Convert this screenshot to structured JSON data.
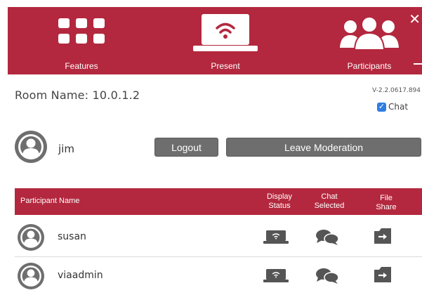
{
  "nav": {
    "features_label": "Features",
    "present_label": "Present",
    "participants_label": "Participants",
    "close_label": "✕"
  },
  "room": {
    "name_text": "Room Name: 10.0.1.2",
    "version": "V-2.2.0617.894",
    "chat_label": "Chat",
    "chat_checked": true
  },
  "user": {
    "name": "jim",
    "logout_label": "Logout",
    "leave_label": "Leave Moderation"
  },
  "table": {
    "col_name": "Participant Name",
    "col_display_1": "Display",
    "col_display_2": "Status",
    "col_chat_1": "Chat",
    "col_chat_2": "Selected",
    "col_file_1": "File",
    "col_file_2": "Share",
    "rows": [
      {
        "name": "susan"
      },
      {
        "name": "viaadmin"
      }
    ]
  },
  "colors": {
    "brand_red": "#b3283e",
    "button_gray": "#6e6e6e",
    "checkbox_blue": "#2f7de1"
  }
}
